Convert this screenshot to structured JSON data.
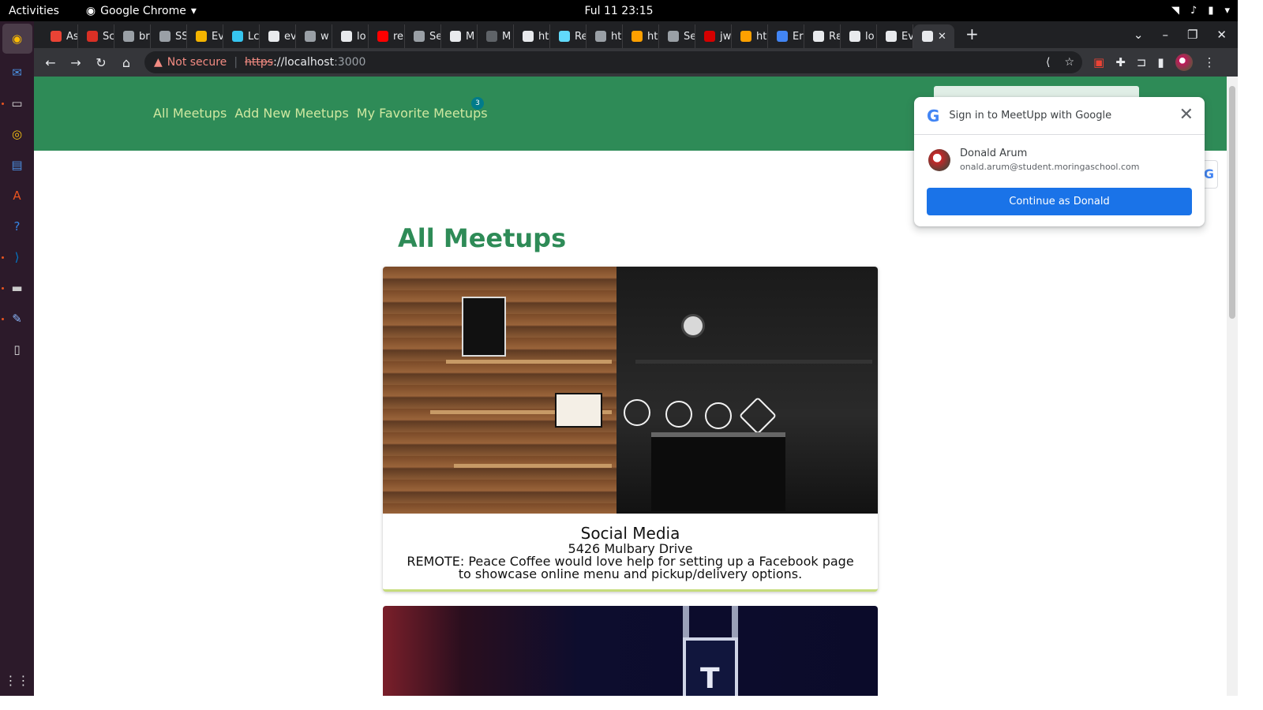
{
  "os": {
    "activities": "Activities",
    "app_name": "Google Chrome",
    "clock": "Ful 11  23:15"
  },
  "tabs": [
    {
      "label": "As",
      "color": "#ea4335"
    },
    {
      "label": "Sc",
      "color": "#d93025"
    },
    {
      "label": "br",
      "color": "#9aa0a6"
    },
    {
      "label": "SS",
      "color": "#9aa0a6"
    },
    {
      "label": "Ev",
      "color": "#f4b400"
    },
    {
      "label": "Lc",
      "color": "#36c5f0"
    },
    {
      "label": "ev",
      "color": "#e8eaed"
    },
    {
      "label": "w",
      "color": "#9aa0a6"
    },
    {
      "label": "lo",
      "color": "#e8eaed"
    },
    {
      "label": "re",
      "color": "#ff0000"
    },
    {
      "label": "Se",
      "color": "#9aa0a6"
    },
    {
      "label": "M",
      "color": "#e8eaed"
    },
    {
      "label": "M",
      "color": "#5f6368"
    },
    {
      "label": "ht",
      "color": "#e8eaed"
    },
    {
      "label": "Re",
      "color": "#61dafb"
    },
    {
      "label": "ht",
      "color": "#9aa0a6"
    },
    {
      "label": "ht",
      "color": "#ffa000"
    },
    {
      "label": "Se",
      "color": "#9aa0a6"
    },
    {
      "label": "jw",
      "color": "#d50000"
    },
    {
      "label": "ht",
      "color": "#ffa000"
    },
    {
      "label": "Er",
      "color": "#4285f4"
    },
    {
      "label": "Rε",
      "color": "#e8eaed"
    },
    {
      "label": "lo",
      "color": "#e8eaed"
    },
    {
      "label": "Ev",
      "color": "#e8eaed"
    }
  ],
  "omnibox": {
    "warning": "Not secure",
    "scheme": "https",
    "host": "://localhost",
    "port": ":3000"
  },
  "nav": {
    "all_meetups": "All Meetups",
    "add_new": "Add New Meetups",
    "favorites": "My Favorite Meetups",
    "favorites_count": "3"
  },
  "page": {
    "heading": "All Meetups"
  },
  "meetups": [
    {
      "title": "Social Media",
      "address": "5426 Mulbary Drive",
      "description": "REMOTE: Peace Coffee would love help for setting up a Facebook page to showcase online menu and pickup/delivery options."
    }
  ],
  "google_signin": {
    "title": "Sign in to MeetUpp with Google",
    "name": "Donald Arum",
    "email": "onald.arum@student.moringaschool.com",
    "button": "Continue as Donald"
  }
}
